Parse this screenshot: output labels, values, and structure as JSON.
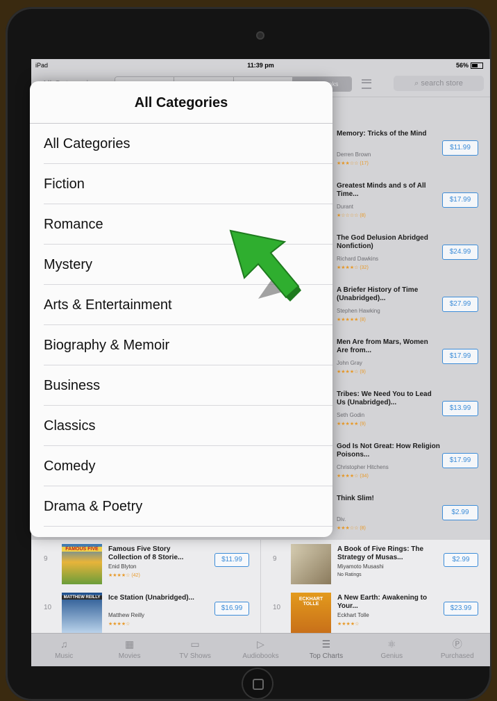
{
  "status": {
    "device": "iPad",
    "time": "11:39 pm",
    "battery": "56%"
  },
  "nav": {
    "category_label": "All Categories",
    "segments": [
      "Music",
      "Movies",
      "TV",
      "Audiobooks"
    ],
    "search_placeholder": "search store"
  },
  "popover": {
    "title": "All Categories",
    "items": [
      "All Categories",
      "Fiction",
      "Romance",
      "Mystery",
      "Arts & Entertainment",
      "Biography & Memoir",
      "Business",
      "Classics",
      "Comedy",
      "Drama & Poetry"
    ]
  },
  "right_list": [
    {
      "title": "Memory: Tricks of the Mind",
      "author": "Derren Brown",
      "stars": "★★★☆☆ (17)",
      "price": "$11.99"
    },
    {
      "title": "Greatest Minds and s of All Time...",
      "author": "Durant",
      "stars": "★☆☆☆☆ (8)",
      "price": "$17.99"
    },
    {
      "title": "The God Delusion Abridged Nonfiction)",
      "author": "Richard Dawkins",
      "stars": "★★★★☆ (32)",
      "price": "$24.99"
    },
    {
      "title": "A Briefer History of Time (Unabridged)...",
      "author": "Stephen Hawking",
      "stars": "★★★★★ (8)",
      "price": "$27.99"
    },
    {
      "title": "Men Are from Mars, Women Are from...",
      "author": "John Gray",
      "stars": "★★★★☆ (9)",
      "price": "$17.99"
    },
    {
      "title": "Tribes: We Need You to Lead Us (Unabridged)...",
      "author": "Seth Godin",
      "stars": "★★★★★ (9)",
      "price": "$13.99"
    },
    {
      "title": "God Is Not Great: How Religion Poisons...",
      "author": "Christopher Hitchens",
      "stars": "★★★★☆ (34)",
      "price": "$17.99"
    },
    {
      "title": "Think Slim!",
      "author": "Div.",
      "stars": "★★★☆☆ (8)",
      "price": "$2.99"
    }
  ],
  "bottom_rows": [
    {
      "rank": "9",
      "title": "Famous Five Story Collection of 8 Storie...",
      "author": "Enid Blyton",
      "stars": "★★★★☆ (42)",
      "price": "$11.99",
      "cover_text": "FAMOUS FIVE"
    },
    {
      "rank": "9",
      "title": "A Book of Five Rings: The Strategy of Musas...",
      "author": "Miyamoto Musashi",
      "stars": "No Ratings",
      "price": "$2.99",
      "cover_text": ""
    },
    {
      "rank": "10",
      "title": "Ice Station (Unabridged)...",
      "author": "Matthew Reilly",
      "stars": "★★★★☆",
      "price": "$16.99",
      "cover_text": "MATTHEW REILLY"
    },
    {
      "rank": "10",
      "title": "A New Earth: Awakening to Your...",
      "author": "Eckhart Tolle",
      "stars": "★★★★☆",
      "price": "$23.99",
      "cover_text": "ECKHART TOLLE"
    }
  ],
  "tabs": [
    "Music",
    "Movies",
    "TV Shows",
    "Audiobooks",
    "Top Charts",
    "Genius",
    "Purchased"
  ],
  "colors": {
    "accent": "#3c8cd8",
    "arrow": "#2fae2f"
  }
}
